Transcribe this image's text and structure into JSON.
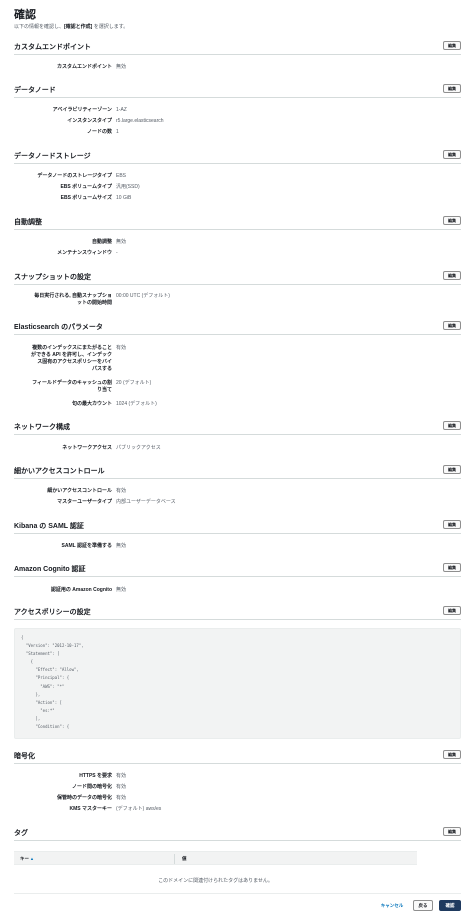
{
  "page": {
    "title": "確認",
    "subtitle_prefix": "以下の情報を確認し、",
    "subtitle_bold": "[確認と作成]",
    "subtitle_suffix": " を選択します。"
  },
  "edit_label": "編集",
  "sections": {
    "custom_endpoint": {
      "title": "カスタムエンドポイント",
      "rows": [
        {
          "label": "カスタムエンドポイント",
          "value": "無効"
        }
      ]
    },
    "data_nodes": {
      "title": "データノード",
      "rows": [
        {
          "label": "アベイラビリティーゾーン",
          "value": "1-AZ"
        },
        {
          "label": "インスタンスタイプ",
          "value": "r5.large.elasticsearch"
        },
        {
          "label": "ノードの数",
          "value": "1"
        }
      ]
    },
    "data_node_storage": {
      "title": "データノードストレージ",
      "rows": [
        {
          "label": "データノードのストレージタイプ",
          "value": "EBS"
        },
        {
          "label": "EBS ボリュームタイプ",
          "value": "汎用(SSD)"
        },
        {
          "label": "EBS ボリュームサイズ",
          "value": "10 GiB"
        }
      ]
    },
    "auto_tune": {
      "title": "自動調整",
      "rows": [
        {
          "label": "自動調整",
          "value": "無効"
        },
        {
          "label": "メンテナンスウィンドウ",
          "value": "-"
        }
      ]
    },
    "snapshot": {
      "title": "スナップショットの設定",
      "rows": [
        {
          "label_line1": "毎日実行される, 自動スナップショ",
          "label_line2": "ットの開始時間",
          "value": "00:00 UTC (デフォルト)"
        }
      ]
    },
    "es_params": {
      "title": "Elasticsearch のパラメータ",
      "rows": [
        {
          "label_line1": "複数のインデックスにまたがること",
          "label_line2": "ができる API を許可し、インデック",
          "label_line3": "ス固有のアクセスポリシーをバイ",
          "label_line4": "パスする",
          "value": "有効"
        },
        {
          "label_line1": "フィールドデータのキャッシュの割",
          "label_line2": "り当て",
          "value": "20 (デフォルト)"
        },
        {
          "label": "句の最大カウント",
          "value": "1024 (デフォルト)"
        }
      ]
    },
    "network": {
      "title": "ネットワーク構成",
      "rows": [
        {
          "label": "ネットワークアクセス",
          "value": "パブリックアクセス"
        }
      ]
    },
    "fine_grained": {
      "title": "細かいアクセスコントロール",
      "rows": [
        {
          "label": "細かいアクセスコントロール",
          "value": "有効"
        },
        {
          "label": "マスターユーザータイプ",
          "value": "内部ユーザーデータベース"
        }
      ]
    },
    "saml": {
      "title": "Kibana の SAML 認証",
      "rows": [
        {
          "label": "SAML 認証を準備する",
          "value": "無効"
        }
      ]
    },
    "cognito": {
      "title": "Amazon Cognito 認証",
      "rows": [
        {
          "label": "認証用の Amazon Cognito",
          "value": "無効"
        }
      ]
    },
    "access_policy": {
      "title": "アクセスポリシーの設定",
      "code": "{\n  \"Version\": \"2012-10-17\",\n  \"Statement\": [\n    {\n      \"Effect\": \"Allow\",\n      \"Principal\": {\n        \"AWS\": \"*\"\n      },\n      \"Action\": [\n        \"es:*\"\n      ],\n      \"Condition\": {"
    },
    "encryption": {
      "title": "暗号化",
      "rows": [
        {
          "label": "HTTPS を要求",
          "value": "有効"
        },
        {
          "label": "ノード間の暗号化",
          "value": "有効"
        },
        {
          "label": "保管時のデータの暗号化",
          "value": "有効"
        },
        {
          "label": "KMS マスターキー",
          "value": "(デフォルト) aws/es"
        }
      ]
    },
    "tags": {
      "title": "タグ",
      "col_key": "キー",
      "col_value": "値",
      "empty": "このドメインに関連付けられたタグはありません。"
    }
  },
  "footer": {
    "cancel": "キャンセル",
    "previous": "戻る",
    "confirm": "確認"
  }
}
